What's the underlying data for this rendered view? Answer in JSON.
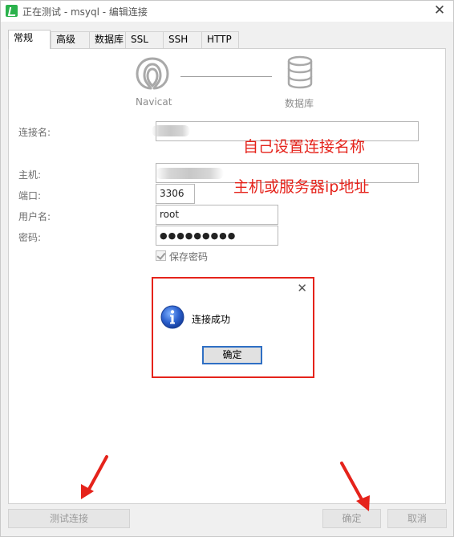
{
  "window": {
    "title": "正在测试 - msyql - 编辑连接",
    "close_glyph": "✕"
  },
  "tabs": [
    {
      "label": "常规",
      "active": true
    },
    {
      "label": "高级",
      "active": false
    },
    {
      "label": "数据库",
      "active": false
    },
    {
      "label": "SSL",
      "active": false
    },
    {
      "label": "SSH",
      "active": false
    },
    {
      "label": "HTTP",
      "active": false
    }
  ],
  "header": {
    "left_label": "Navicat",
    "right_label": "数据库"
  },
  "form": {
    "connection_name_label": "连接名:",
    "connection_name_value": "",
    "host_label": "主机:",
    "host_value": "",
    "port_label": "端口:",
    "port_value": "3306",
    "user_label": "用户名:",
    "user_value": "root",
    "password_label": "密码:",
    "password_value": "●●●●●●●●●",
    "save_password_label": "保存密码",
    "save_password_checked": true
  },
  "annotations": {
    "connection_name_note": "自己设置连接名称",
    "host_note": "主机或服务器ip地址",
    "color": "#e5231b"
  },
  "dialog": {
    "message": "连接成功",
    "ok_label": "确定",
    "close_glyph": "✕",
    "icon": "info-icon"
  },
  "footer": {
    "test_button": "测试连接",
    "ok_button": "确定",
    "cancel_button": "取消"
  },
  "colors": {
    "accent_red": "#e5231b",
    "focus_blue": "#2f6fc4",
    "info_blue": "#1f4fb4"
  }
}
